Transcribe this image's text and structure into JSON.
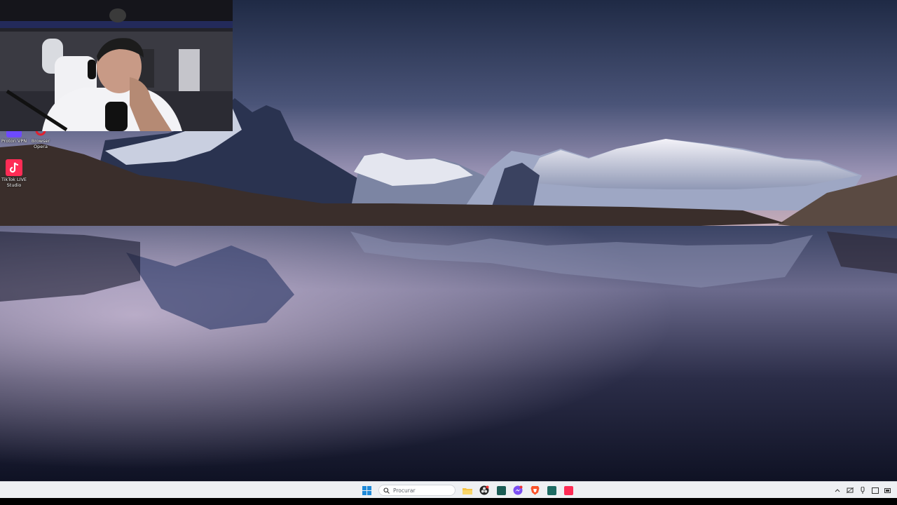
{
  "desktop": {
    "icons": [
      {
        "label": "Proton VPN",
        "icon": "proton-vpn-icon",
        "color": "#6d4aff"
      },
      {
        "label": "Browser\nOpera",
        "icon": "opera-browser-icon",
        "color": "#e0202f"
      },
      {
        "label": "TikTok LIVE\nStudio",
        "icon": "tiktok-live-studio-icon",
        "color": "#fe2c55"
      }
    ]
  },
  "taskbar": {
    "search_placeholder": "Procurar",
    "pinned_apps": [
      {
        "icon": "file-explorer-icon",
        "color": "#f6c445"
      },
      {
        "icon": "obs-studio-icon",
        "color": "#222222"
      },
      {
        "icon": "terminal-app-icon",
        "color": "#1b5c55"
      },
      {
        "icon": "messenger-icon",
        "color": "#7b4ef2"
      },
      {
        "icon": "brave-browser-icon",
        "color": "#fb542b"
      },
      {
        "icon": "code-editor-icon",
        "color": "#1e6b63"
      },
      {
        "icon": "tiktok-live-studio-icon",
        "color": "#fe2c55"
      }
    ],
    "tray_icons": [
      "chevron-up-icon",
      "network-icon",
      "speaker-icon",
      "notification-icon",
      "battery-icon"
    ]
  },
  "colors": {
    "taskbar_bg": "#eef0f3",
    "windows_start_blue": "#1f8ad9"
  }
}
